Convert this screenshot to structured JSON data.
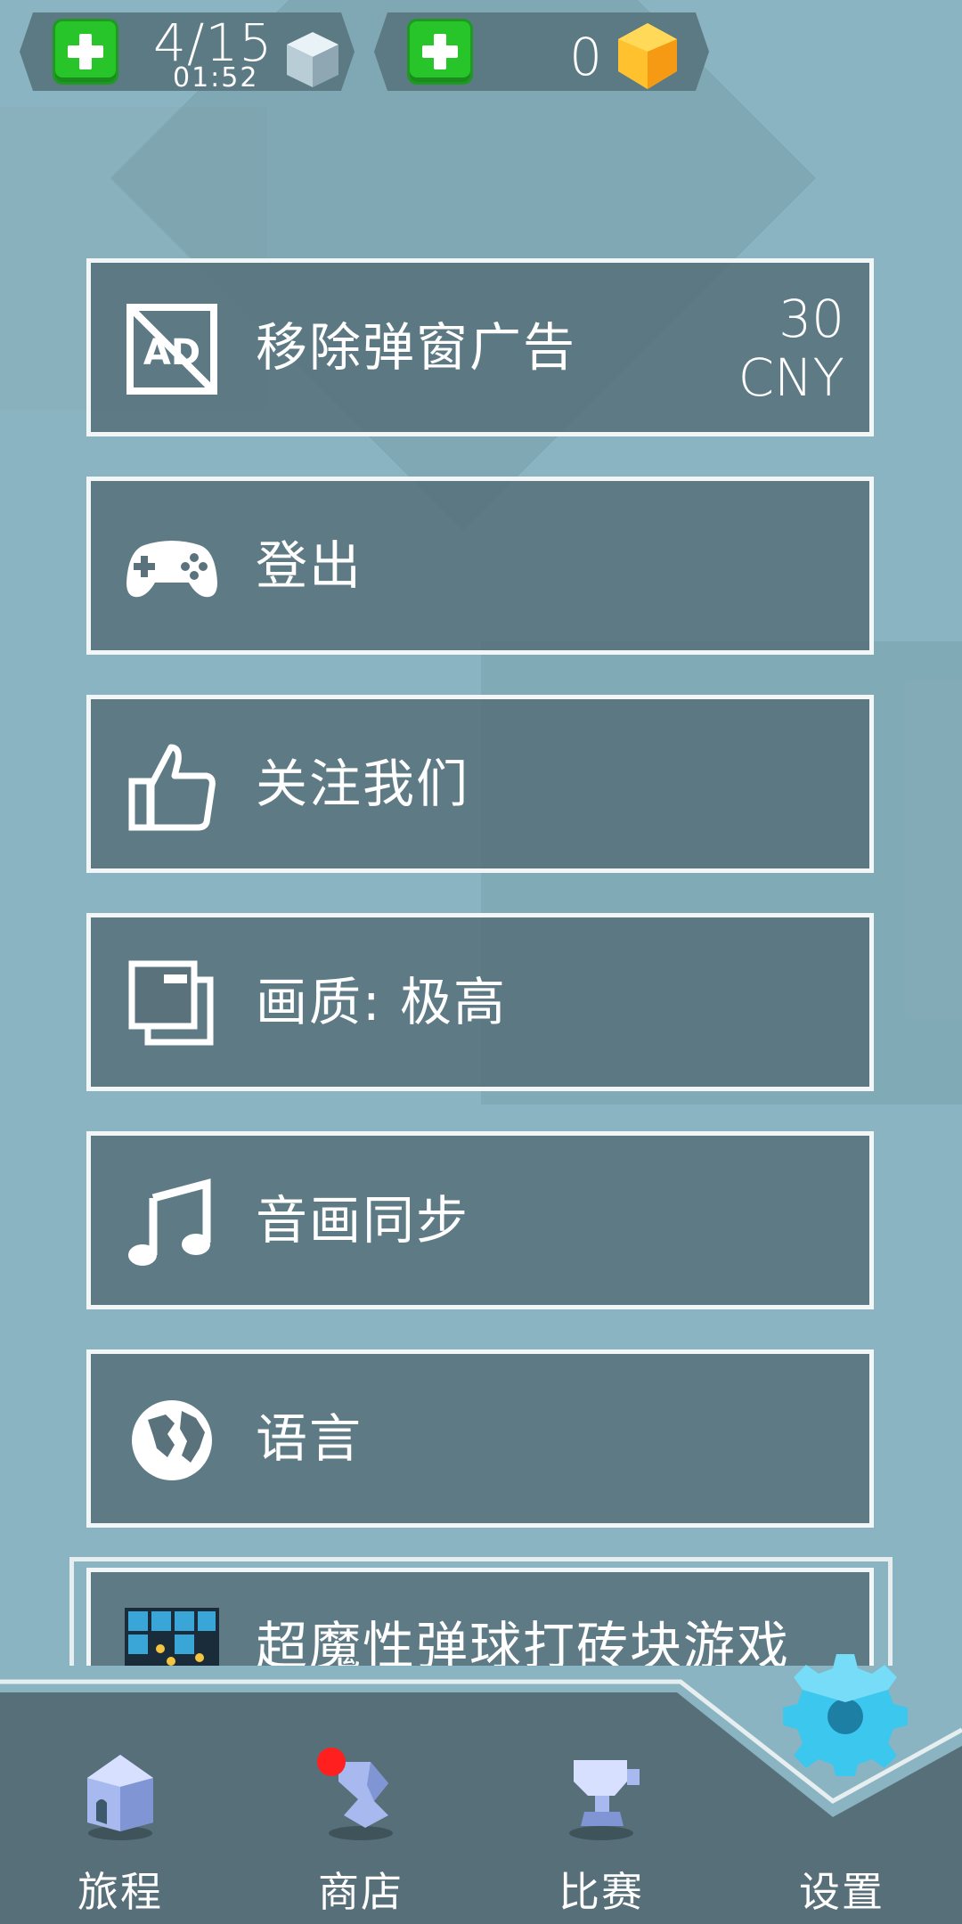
{
  "hud": {
    "energy": {
      "value": "4/15",
      "timer": "01:52",
      "add_icon": "plus-icon",
      "resource_icon": "cube-icon"
    },
    "gems": {
      "value": "0",
      "add_icon": "plus-icon",
      "resource_icon": "gem-icon"
    }
  },
  "menu": [
    {
      "id": "remove-ads",
      "label": "移除弹窗广告",
      "icon": "no-ads-icon",
      "price_value": "30",
      "price_currency": "CNY"
    },
    {
      "id": "sign-out",
      "label": "登出",
      "icon": "gamepad-icon"
    },
    {
      "id": "follow-us",
      "label": "关注我们",
      "icon": "thumbs-up-icon"
    },
    {
      "id": "graphics-quality",
      "label": "画质: 极高",
      "icon": "windows-icon"
    },
    {
      "id": "audio-sync",
      "label": "音画同步",
      "icon": "music-note-icon"
    },
    {
      "id": "language",
      "label": "语言",
      "icon": "globe-icon"
    },
    {
      "id": "promo-game",
      "label": "超魔性弹球打砖块游戏",
      "icon": "game-thumbnail-icon"
    }
  ],
  "nav": {
    "tabs": [
      {
        "label": "旅程",
        "icon": "house-icon"
      },
      {
        "label": "商店",
        "icon": "shop-icon",
        "badge": true
      },
      {
        "label": "比赛",
        "icon": "trophy-icon"
      },
      {
        "label": "设置",
        "icon": "gear-icon",
        "active": true
      }
    ]
  },
  "colors": {
    "background": "#8ab4c2",
    "panel": "#576f79",
    "button": "#546e78",
    "plus_green": "#27c42a",
    "gear_blue": "#3cc7ef",
    "badge_red": "#ff1f1f"
  }
}
